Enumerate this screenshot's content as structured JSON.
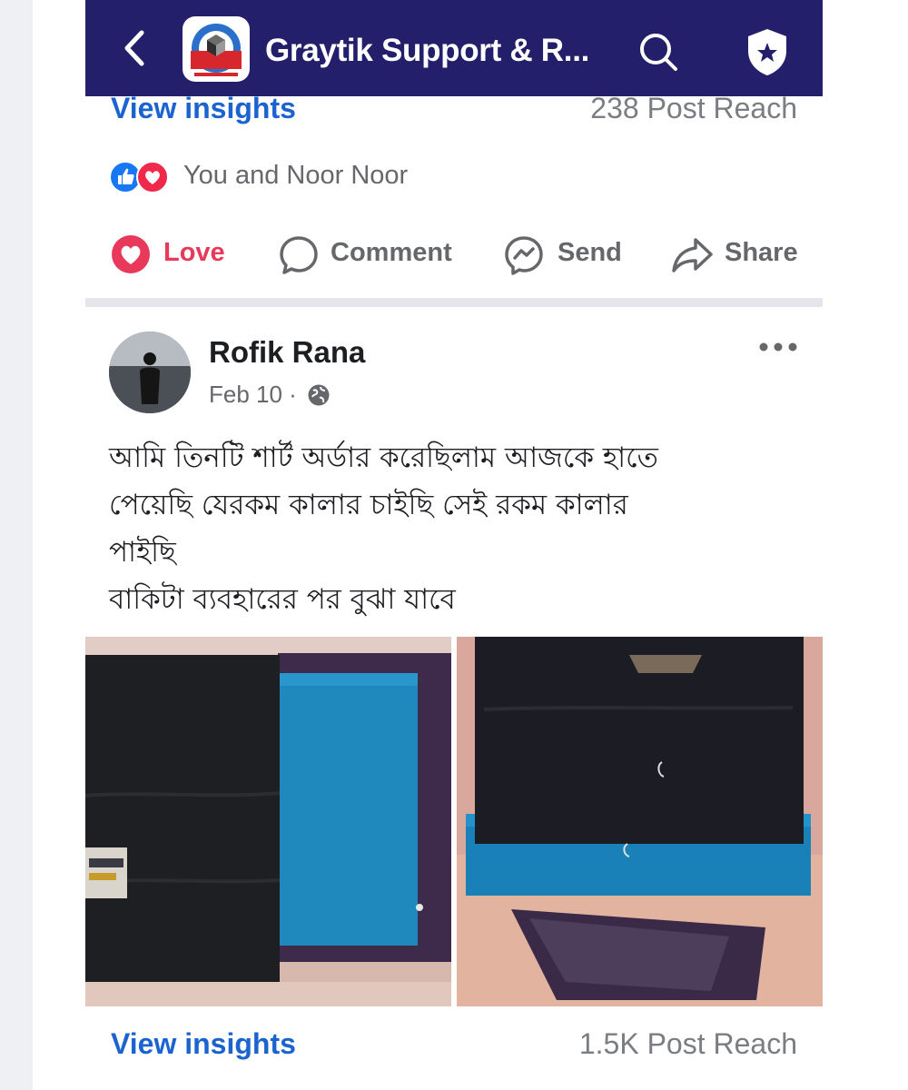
{
  "header": {
    "title": "Graytik Support & R...",
    "back_icon": "arrow-back-icon",
    "search_icon": "search-icon",
    "shield_icon": "shield-star-icon",
    "background": "#241f6b"
  },
  "post1": {
    "insights_label": "View insights",
    "reach": "238 Post Reach",
    "reactions_text": "You and Noor Noor",
    "reaction_icons": [
      "like-icon",
      "love-icon"
    ],
    "actions": [
      {
        "label": "Love",
        "icon": "love-icon"
      },
      {
        "label": "Comment",
        "icon": "comment-icon"
      },
      {
        "label": "Send",
        "icon": "messenger-icon"
      },
      {
        "label": "Share",
        "icon": "share-icon"
      }
    ]
  },
  "post2": {
    "author": "Rofik Rana",
    "date": "Feb 10 ·",
    "privacy_icon": "globe-icon",
    "text_lines": [
      "আমি তিনটি শার্ট অর্ডার করেছিলাম আজকে হাতে",
      "পেয়েছি যেরকম কালার চাইছি সেই রকম কালার",
      "পাইছি",
      "বাকিটা ব্যবহারের পর বুঝা যাবে"
    ],
    "photos": [
      "black-and-blue-shirts-photo",
      "folded-black-and-blue-shirts-photo"
    ],
    "insights_label": "View insights",
    "reach": "1.5K Post Reach"
  },
  "colors": {
    "accent": "#1b63cf",
    "love": "#e8395a",
    "muted": "#65676b"
  }
}
